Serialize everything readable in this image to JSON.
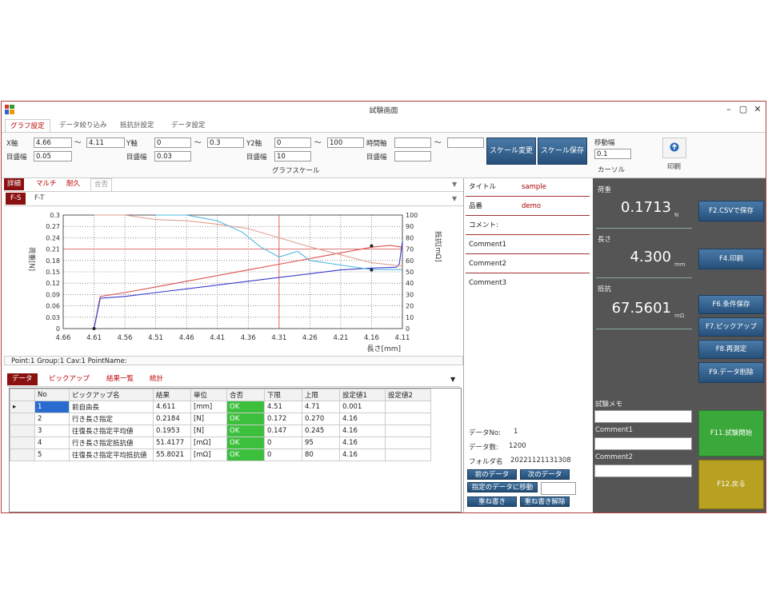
{
  "window": {
    "title": "試験画面",
    "minimize": "–",
    "maximize": "▢",
    "close": "✕"
  },
  "tabs": [
    "グラフ設定",
    "データ絞り込み",
    "抵抗計設定",
    "データ設定"
  ],
  "scale": {
    "x_label": "X軸",
    "x_min": "4.66",
    "x_max": "4.11",
    "x_step_label": "目盛幅",
    "x_step": "0.05",
    "y_label": "Y軸",
    "y_min": "0",
    "y_max": "0.3",
    "y_step_label": "目盛幅",
    "y_step": "0.03",
    "y2_label": "Y2軸",
    "y2_min": "0",
    "y2_max": "100",
    "y2_step_label": "目盛幅",
    "y2_step": "10",
    "time_label": "時間軸",
    "time_min": "",
    "time_max": "",
    "time_step_label": "目盛幅",
    "time_step": "",
    "tilde": "～",
    "group_label": "グラフスケール",
    "change_button": "スケール変更",
    "save_button": "スケール保存",
    "move_label": "移動幅",
    "move_value": "0.1",
    "cursor_label": "カーソル",
    "print_label": "印刷"
  },
  "view_tabs": [
    "詳細",
    "マルチ",
    "耐久",
    "合否"
  ],
  "graph_tabs": [
    "F-S",
    "F-T"
  ],
  "chart_data": {
    "type": "line",
    "xlabel": "長さ[mm]",
    "ylabel": "荷重[N]",
    "y2label": "抵抗[mΩ]",
    "xlim": [
      4.66,
      4.11
    ],
    "ylim": [
      0,
      0.3
    ],
    "y2lim": [
      0,
      100
    ],
    "x_ticks": [
      "4.66",
      "4.61",
      "4.56",
      "4.51",
      "4.46",
      "4.41",
      "4.36",
      "4.31",
      "4.26",
      "4.21",
      "4.16",
      "4.11"
    ],
    "y_ticks": [
      "0",
      "0.03",
      "0.06",
      "0.09",
      "0.12",
      "0.15",
      "0.18",
      "0.21",
      "0.24",
      "0.27",
      "0.3"
    ],
    "y2_ticks": [
      "0",
      "10",
      "20",
      "30",
      "40",
      "50",
      "60",
      "70",
      "80",
      "90",
      "100"
    ],
    "grid": true,
    "series": [
      {
        "color": "#e05050",
        "axis": "y",
        "x": [
          4.61,
          4.6,
          4.56,
          4.51,
          4.46,
          4.41,
          4.36,
          4.31,
          4.26,
          4.21,
          4.16,
          4.13,
          4.11
        ],
        "y": [
          0.0,
          0.085,
          0.095,
          0.11,
          0.125,
          0.14,
          0.155,
          0.17,
          0.185,
          0.2,
          0.215,
          0.22,
          0.215
        ]
      },
      {
        "color": "#3a3ad0",
        "axis": "y",
        "x": [
          4.61,
          4.6,
          4.56,
          4.51,
          4.46,
          4.41,
          4.36,
          4.31,
          4.26,
          4.21,
          4.16,
          4.12,
          4.115,
          4.11
        ],
        "y": [
          0.0,
          0.08,
          0.085,
          0.095,
          0.105,
          0.115,
          0.125,
          0.135,
          0.145,
          0.155,
          0.16,
          0.162,
          0.17,
          0.23
        ]
      },
      {
        "color": "#e0a090",
        "axis": "y2",
        "x": [
          4.61,
          4.56,
          4.51,
          4.46,
          4.41,
          4.36,
          4.31,
          4.26,
          4.21,
          4.16,
          4.11
        ],
        "y": [
          100,
          100,
          96,
          95,
          92,
          88,
          80,
          72,
          65,
          58,
          55
        ]
      },
      {
        "color": "#50b8e0",
        "axis": "y2",
        "x": [
          4.51,
          4.46,
          4.41,
          4.37,
          4.34,
          4.31,
          4.28,
          4.26,
          4.21,
          4.16,
          4.11
        ],
        "y": [
          100,
          100,
          95,
          85,
          72,
          63,
          68,
          60,
          56,
          52,
          52
        ]
      }
    ],
    "cursor_x": 4.31,
    "hline_y": 0.21
  },
  "statusline": "Point:1  Group:1  Cav:1  PointName:",
  "bottom_tabs": [
    "データ",
    "ピックアップ",
    "結果一覧",
    "統計"
  ],
  "table": {
    "headers": [
      "",
      "No",
      "ピックアップ名",
      "結果",
      "単位",
      "合否",
      "下限",
      "上限",
      "設定値1",
      "設定値2"
    ],
    "rows": [
      [
        "▸",
        "1",
        "前自由長",
        "4.611",
        "[mm]",
        "OK",
        "4.51",
        "4.71",
        "0.001",
        ""
      ],
      [
        "",
        "2",
        "行き長さ指定",
        "0.2184",
        "[N]",
        "OK",
        "0.172",
        "0.270",
        "4.16",
        ""
      ],
      [
        "",
        "3",
        "往復長さ指定平均値",
        "0.1953",
        "[N]",
        "OK",
        "0.147",
        "0.245",
        "4.16",
        ""
      ],
      [
        "",
        "4",
        "行き長さ指定抵抗値",
        "51.4177",
        "[mΩ]",
        "OK",
        "0",
        "95",
        "4.16",
        ""
      ],
      [
        "",
        "5",
        "往復長さ指定平均抵抗値",
        "55.8021",
        "[mΩ]",
        "OK",
        "0",
        "80",
        "4.16",
        ""
      ]
    ]
  },
  "info": {
    "title_label": "タイトル",
    "title_value": "sample",
    "part_label": "品番",
    "part_value": "demo",
    "comment_label": "コメント:",
    "comment1": "Comment1",
    "comment2": "Comment2",
    "comment3": "Comment3",
    "data_no_label": "データNo:",
    "data_no": "1",
    "data_count_label": "データ数:",
    "data_count": "1200",
    "folder_label": "フォルダ名",
    "folder": "20221121131308",
    "prev_button": "前のデータ",
    "next_button": "次のデータ",
    "jump_button": "指定のデータに移動",
    "jump_value": "",
    "overlay_button": "重ね書き",
    "overlay_clear_button": "重ね書き解除"
  },
  "measure": {
    "load_label": "荷重",
    "load_value": "0.1713",
    "load_unit": "N",
    "length_label": "長さ",
    "length_value": "4.300",
    "length_unit": "mm",
    "resist_label": "抵抗",
    "resist_value": "67.5601",
    "resist_unit": "mΩ",
    "memo_label": "試験メモ",
    "memo1_label": "Comment1",
    "memo2_label": "Comment2"
  },
  "fkeys": {
    "f2": "F2.CSVで保存",
    "f4": "F4.印刷",
    "f6": "F6.条件保存",
    "f7": "F7.ピックアップ",
    "f8": "F8.再測定",
    "f9": "F9.データ削除",
    "f11": "F11.試験開始",
    "f12": "F12.戻る",
    "f11_color": "#3aa83a",
    "f12_color": "#b8a020"
  }
}
